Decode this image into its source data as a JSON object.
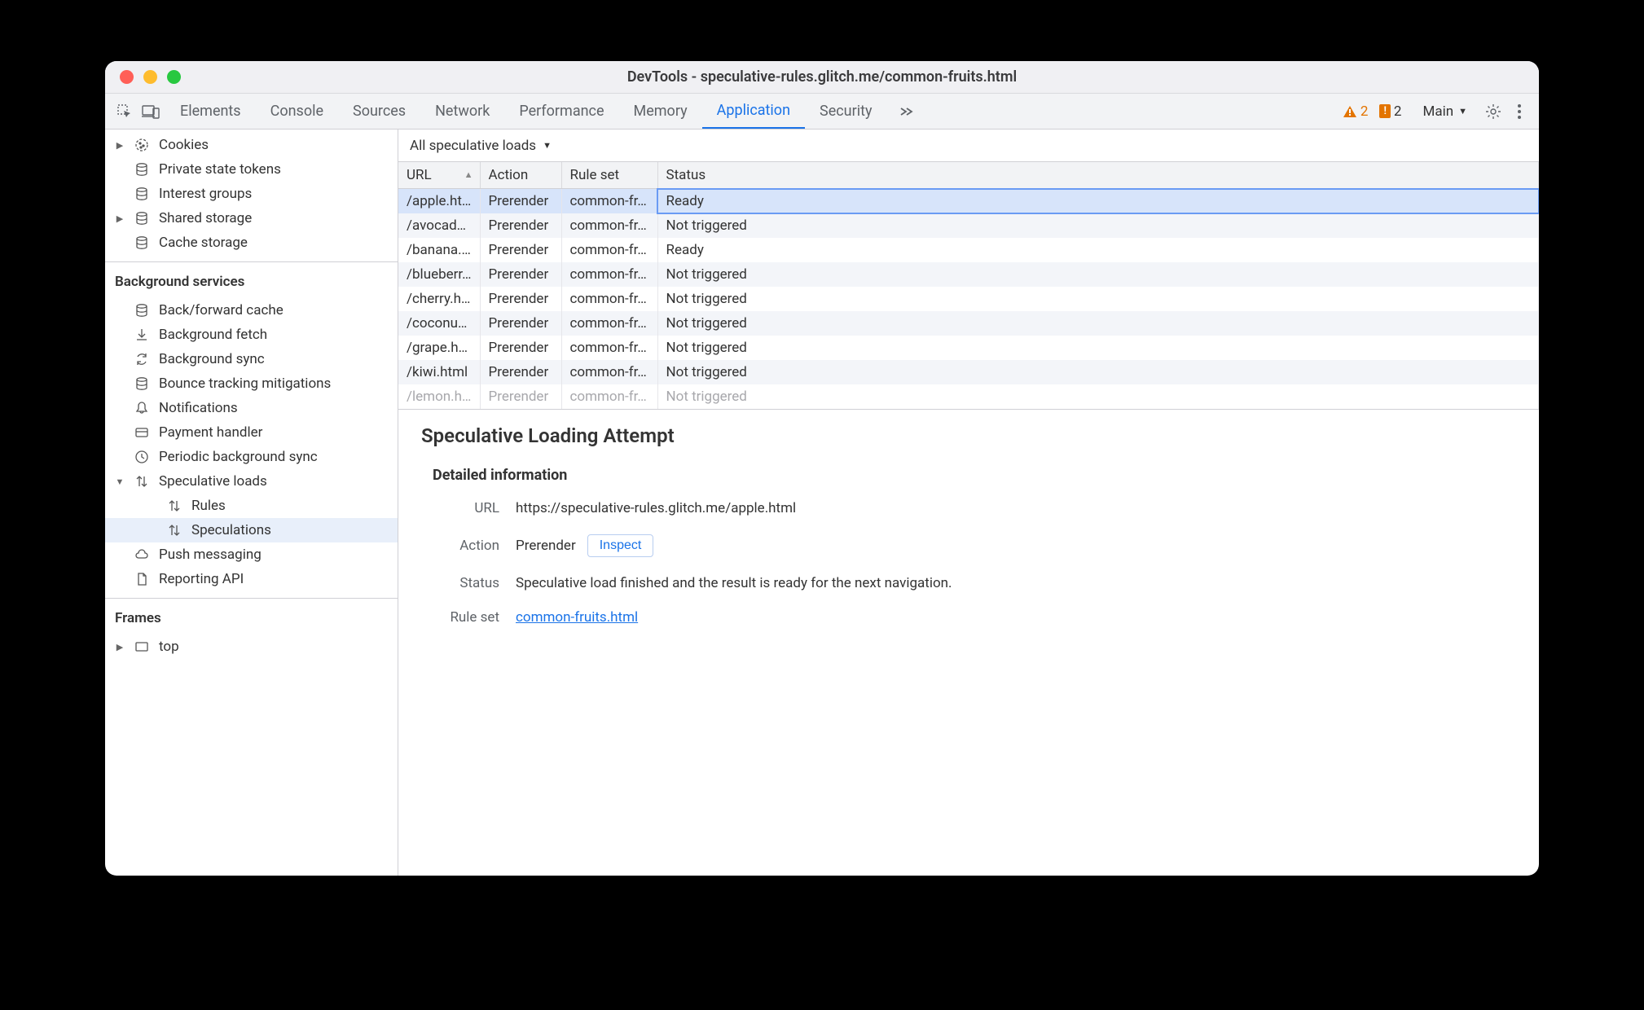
{
  "window_title": "DevTools - speculative-rules.glitch.me/common-fruits.html",
  "tabs": [
    "Elements",
    "Console",
    "Sources",
    "Network",
    "Performance",
    "Memory",
    "Application",
    "Security"
  ],
  "active_tab": "Application",
  "warning_count": "2",
  "issue_count": "2",
  "target_label": "Main",
  "sidebar": {
    "storage": [
      {
        "label": "Cookies",
        "icon": "cookies",
        "expandable": true
      },
      {
        "label": "Private state tokens",
        "icon": "db"
      },
      {
        "label": "Interest groups",
        "icon": "db"
      },
      {
        "label": "Shared storage",
        "icon": "db",
        "expandable": true
      },
      {
        "label": "Cache storage",
        "icon": "db"
      }
    ],
    "bg_title": "Background services",
    "bg": [
      {
        "label": "Back/forward cache",
        "icon": "db"
      },
      {
        "label": "Background fetch",
        "icon": "download"
      },
      {
        "label": "Background sync",
        "icon": "sync"
      },
      {
        "label": "Bounce tracking mitigations",
        "icon": "db"
      },
      {
        "label": "Notifications",
        "icon": "bell"
      },
      {
        "label": "Payment handler",
        "icon": "card"
      },
      {
        "label": "Periodic background sync",
        "icon": "clock"
      },
      {
        "label": "Speculative loads",
        "icon": "swap",
        "expandable": true,
        "expanded": true
      },
      {
        "label": "Rules",
        "icon": "swap",
        "indent": true
      },
      {
        "label": "Speculations",
        "icon": "swap",
        "indent": true,
        "selected": true
      },
      {
        "label": "Push messaging",
        "icon": "cloud"
      },
      {
        "label": "Reporting API",
        "icon": "file"
      }
    ],
    "frames_title": "Frames",
    "frames": [
      {
        "label": "top",
        "icon": "frame",
        "expandable": true
      }
    ]
  },
  "filter_label": "All speculative loads",
  "columns": [
    "URL",
    "Action",
    "Rule set",
    "Status"
  ],
  "rows": [
    {
      "url": "/apple.html",
      "action": "Prerender",
      "ruleset": "common-fr…",
      "status": "Ready",
      "selected": true
    },
    {
      "url": "/avocad…",
      "action": "Prerender",
      "ruleset": "common-fr…",
      "status": "Not triggered"
    },
    {
      "url": "/banana.…",
      "action": "Prerender",
      "ruleset": "common-fr…",
      "status": "Ready"
    },
    {
      "url": "/blueberr…",
      "action": "Prerender",
      "ruleset": "common-fr…",
      "status": "Not triggered"
    },
    {
      "url": "/cherry.h…",
      "action": "Prerender",
      "ruleset": "common-fr…",
      "status": "Not triggered"
    },
    {
      "url": "/coconut…",
      "action": "Prerender",
      "ruleset": "common-fr…",
      "status": "Not triggered"
    },
    {
      "url": "/grape.html",
      "action": "Prerender",
      "ruleset": "common-fr…",
      "status": "Not triggered"
    },
    {
      "url": "/kiwi.html",
      "action": "Prerender",
      "ruleset": "common-fr…",
      "status": "Not triggered"
    }
  ],
  "cutoff_row": {
    "url": "/lemon.h…",
    "action": "Prerender",
    "ruleset": "common-fr…",
    "status": "Not triggered"
  },
  "details": {
    "heading": "Speculative Loading Attempt",
    "subheading": "Detailed information",
    "url_label": "URL",
    "url_value": "https://speculative-rules.glitch.me/apple.html",
    "action_label": "Action",
    "action_value": "Prerender",
    "inspect_label": "Inspect",
    "status_label": "Status",
    "status_value": "Speculative load finished and the result is ready for the next navigation.",
    "ruleset_label": "Rule set",
    "ruleset_link": "common-fruits.html"
  }
}
